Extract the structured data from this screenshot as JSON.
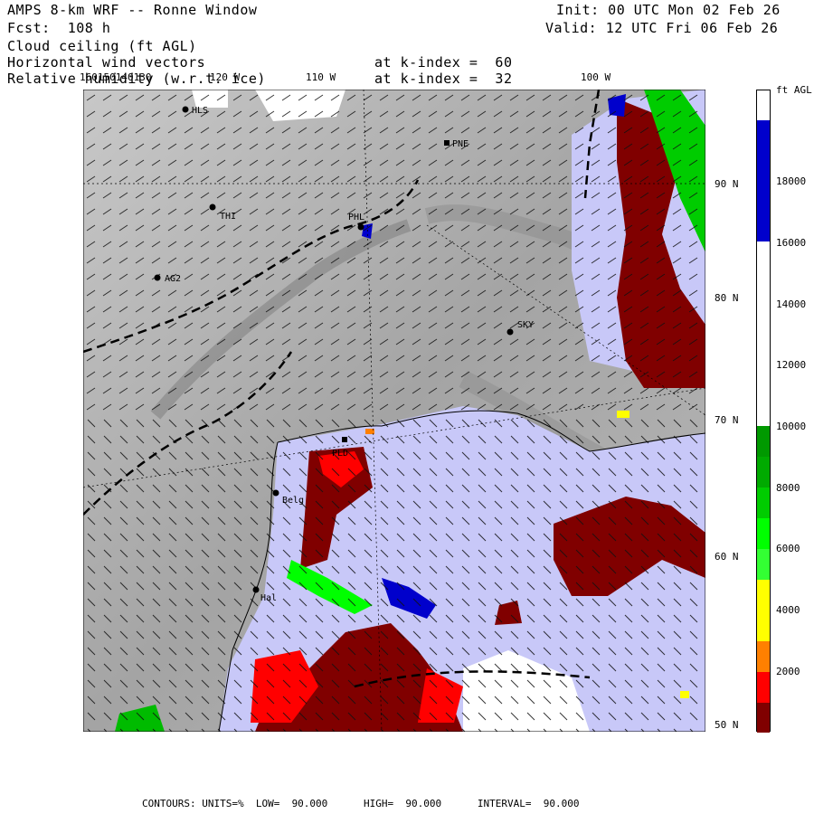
{
  "header": {
    "title": "AMPS 8-km WRF -- Ronne Window",
    "fcst": "Fcst:  108 h",
    "init": "Init: 00 UTC Mon 02 Feb 26",
    "valid": "Valid: 12 UTC Fri 06 Feb 26",
    "field1": "Cloud ceiling (ft AGL)",
    "field2": "Horizontal wind vectors",
    "field3": "Relative humidity (w.r.t. ice)",
    "k1": "at k-index =  60",
    "k2": "at k-index =  32"
  },
  "lon_labels": [
    "160150140130",
    "120 W",
    "110 W",
    "100 W"
  ],
  "lat_labels": [
    "90 N",
    "80 N",
    "70 N",
    "60 N",
    "50 N"
  ],
  "stations": [
    "HLS",
    "PNE",
    "THI",
    "PHL",
    "AG2",
    "SKY",
    "PLD",
    "Belg",
    "Hal"
  ],
  "colorbar": {
    "unit": "ft AGL",
    "labels": [
      "18000",
      "16000",
      "14000",
      "12000",
      "10000",
      "8000",
      "6000",
      "4000",
      "2000"
    ],
    "colors": {
      "above": "#ffffff",
      "blue": "#0000cc",
      "white": "#ffffff",
      "green_dark": "#009900",
      "green_mid": "#00bb00",
      "green_light": "#00ff00",
      "yellow": "#ffff00",
      "orange": "#ff8000",
      "red": "#ff0000",
      "maroon": "#800000"
    }
  },
  "footer": "CONTOURS: UNITS=%  LOW=  90.000      HIGH=  90.000      INTERVAL=  90.000",
  "colors": {
    "land_gray": "#a8a8a8",
    "ice_shelf": "#c8c8f8",
    "sea": "#c8c8f8"
  }
}
